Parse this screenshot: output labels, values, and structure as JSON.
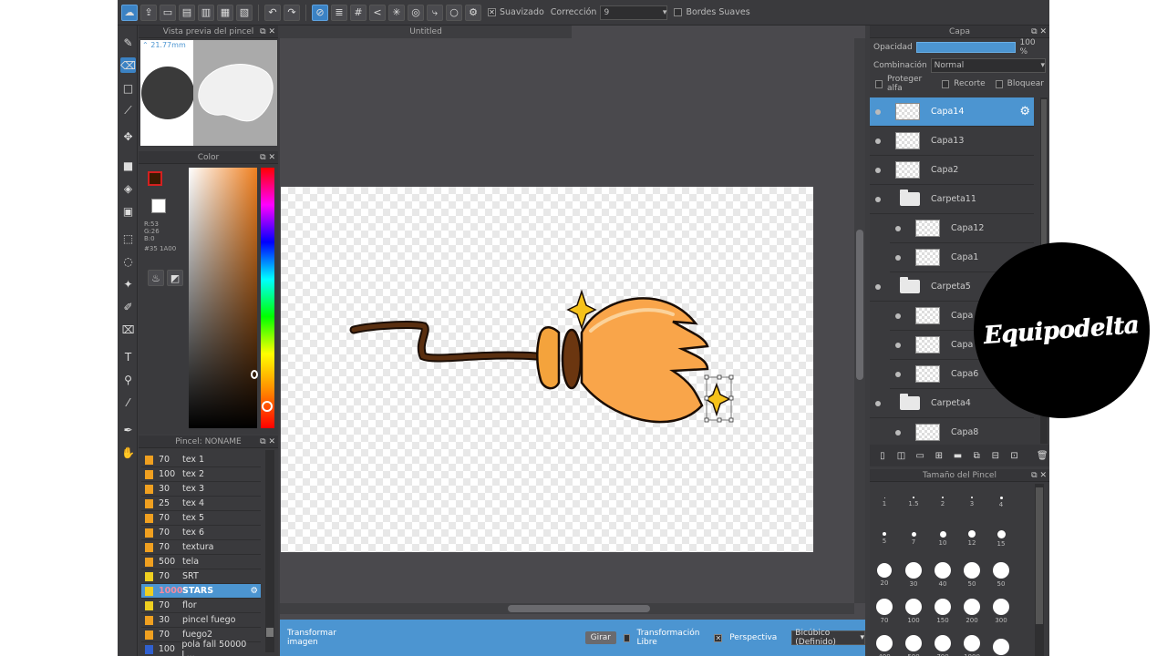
{
  "toolbar": {
    "smooth_label": "Suavizado",
    "correction_label": "Corrección",
    "correction_value": "9",
    "soft_edges_label": "Bordes Suaves"
  },
  "brush_preview": {
    "title": "Vista previa del pincel",
    "size": "⌃ 21.77mm"
  },
  "color_panel": {
    "title": "Color",
    "r": "R:53",
    "g": "G:26",
    "b": "B:0",
    "hex": "#35 1A00",
    "primary_color": "#d42020",
    "secondary_color": "#3a1a00"
  },
  "brush_list": {
    "title": "Pincel: NONAME",
    "items": [
      {
        "size": "70",
        "name": "tex 1",
        "color": "#f0a020"
      },
      {
        "size": "100",
        "name": "tex 2",
        "color": "#f0a020"
      },
      {
        "size": "30",
        "name": "tex 3",
        "color": "#f0a020"
      },
      {
        "size": "25",
        "name": "tex 4",
        "color": "#f0a020"
      },
      {
        "size": "70",
        "name": "tex 5",
        "color": "#f0a020"
      },
      {
        "size": "70",
        "name": "tex 6",
        "color": "#f0a020"
      },
      {
        "size": "70",
        "name": "textura",
        "color": "#f0a020"
      },
      {
        "size": "500",
        "name": "tela",
        "color": "#f0a020"
      },
      {
        "size": "70",
        "name": "SRT",
        "color": "#f0d020"
      },
      {
        "size": "1000",
        "name": "STARS",
        "color": "#f0d020"
      },
      {
        "size": "70",
        "name": "flor",
        "color": "#f0d020"
      },
      {
        "size": "30",
        "name": "pincel fuego",
        "color": "#f0a020"
      },
      {
        "size": "70",
        "name": "fuego2",
        "color": "#f0a020"
      },
      {
        "size": "100",
        "name": "pola fall 50000 L...",
        "color": "#3060d0"
      }
    ]
  },
  "document": {
    "tab_title": "Untitled"
  },
  "transform_bar": {
    "label": "Transformar imagen",
    "rotate_label": "Girar",
    "free_transform_label": "Transformación Libre",
    "perspective_label": "Perspectiva",
    "interp_value": "Bicúbico (Definido)"
  },
  "layer_panel": {
    "title": "Capa",
    "opacity_label": "Opacidad",
    "opacity_value": "100 %",
    "opacity_fraction": 1.0,
    "blend_label": "Combinación",
    "blend_value": "Normal",
    "protect_alpha": "Proteger alfa",
    "clipping": "Recorte",
    "lock": "Bloquear",
    "layers": [
      {
        "name": "Capa14",
        "type": "layer",
        "indent": 0,
        "selected": true
      },
      {
        "name": "Capa13",
        "type": "layer",
        "indent": 0
      },
      {
        "name": "Capa2",
        "type": "layer",
        "indent": 0
      },
      {
        "name": "Carpeta11",
        "type": "folder",
        "indent": 0
      },
      {
        "name": "Capa12",
        "type": "layer",
        "indent": 1
      },
      {
        "name": "Capa1",
        "type": "layer",
        "indent": 1
      },
      {
        "name": "Carpeta5",
        "type": "folder",
        "indent": 0
      },
      {
        "name": "Capa",
        "type": "layer",
        "indent": 1
      },
      {
        "name": "Capa",
        "type": "layer",
        "indent": 1
      },
      {
        "name": "Capa6",
        "type": "layer",
        "indent": 1
      },
      {
        "name": "Carpeta4",
        "type": "folder",
        "indent": 0
      },
      {
        "name": "Capa8",
        "type": "layer",
        "indent": 1
      }
    ]
  },
  "size_panel": {
    "title": "Tamaño del Pincel",
    "sizes": [
      "1",
      "1.5",
      "2",
      "3",
      "4",
      "5",
      "7",
      "10",
      "12",
      "15",
      "20",
      "30",
      "40",
      "50",
      "50",
      "70",
      "100",
      "150",
      "200",
      "300",
      "400",
      "500",
      "700",
      "1000",
      ""
    ]
  },
  "watermark": {
    "text": "Equipodelta"
  }
}
